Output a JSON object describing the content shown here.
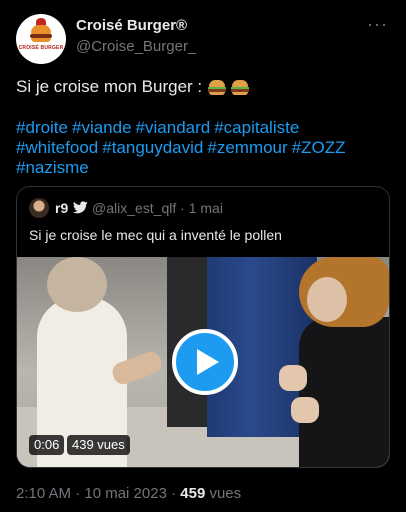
{
  "author": {
    "name": "Croisé Burger®",
    "handle": "@Croise_Burger_",
    "avatar_text": "CROISÉ BURGER"
  },
  "more_icon": "···",
  "tweet": {
    "text": "Si je croise mon Burger :",
    "hashtags": [
      "#droite",
      "#viande",
      "#viandard",
      "#capitaliste",
      "#whitefood",
      "#tanguydavid",
      "#zemmour",
      "#ZOZZ",
      "#nazisme"
    ]
  },
  "quote": {
    "name": "r9",
    "verified_icon": "twitter-bird-icon",
    "handle_time": "@alix_est_qlf · 1 mai",
    "text": "Si je croise le mec qui a inventé le pollen",
    "video": {
      "duration": "0:06",
      "views": "439 vues",
      "play_icon": "play-icon"
    }
  },
  "meta": {
    "timestamp": "2:10 AM · 10 mai 2023 · ",
    "view_count": "459",
    "view_label": " vues"
  },
  "colors": {
    "background": "#000000",
    "text": "#e7e9ea",
    "secondary": "#71767b",
    "link": "#1d9bf0",
    "border": "#2f3336"
  }
}
